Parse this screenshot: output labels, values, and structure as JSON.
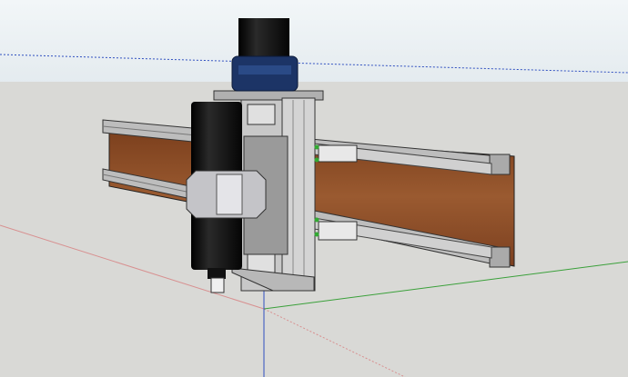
{
  "viewport": {
    "sky_color": "#eef3f6",
    "ground_color": "#d9d9d6",
    "axis_colors": {
      "red": "#d08080",
      "green": "#3aa03a",
      "blue": "#3050c0"
    },
    "model": {
      "motor_color": "#0a0a0a",
      "motor_mount_color": "#1c3466",
      "plate_color": "#c8c8c8",
      "wood_color": "#8a4a24",
      "rail_color": "#b8b8b8",
      "spindle_color": "#101010",
      "clamp_color": "#c4c4c8"
    }
  }
}
